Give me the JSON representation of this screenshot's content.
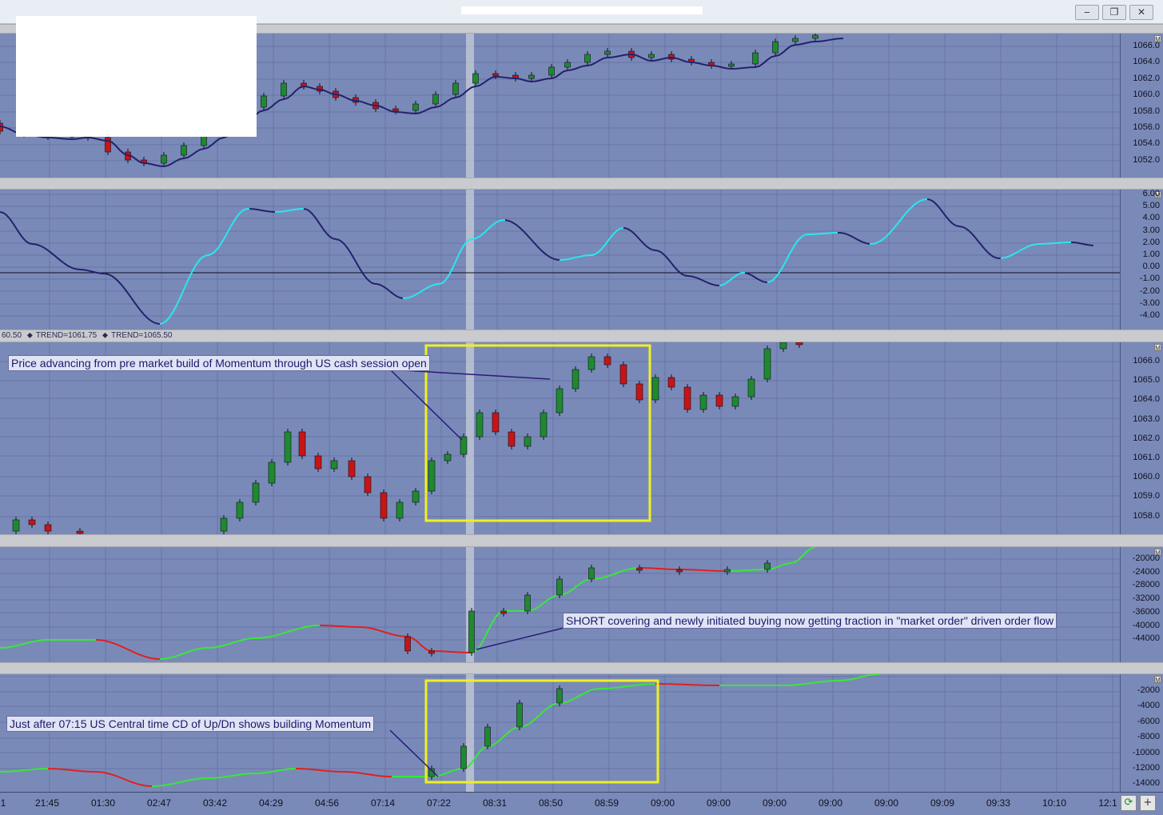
{
  "window": {
    "buttons": [
      "‒",
      "❐",
      "✕"
    ]
  },
  "panes": [
    {
      "id": "price-pane",
      "ticks": [
        "1066.0",
        "1064.0",
        "1062.0",
        "1060.0",
        "1058.0",
        "1056.0",
        "1054.0",
        "1052.0"
      ],
      "badge": "M"
    },
    {
      "id": "oscillator-pane",
      "ticks": [
        "6.00",
        "5.00",
        "4.00",
        "3.00",
        "2.00",
        "1.00",
        "0.00",
        "-1.00",
        "-2.00",
        "-3.00",
        "-4.00"
      ],
      "badge": "M"
    },
    {
      "id": "range-pane",
      "ticks": [
        "1066.0",
        "1065.0",
        "1064.0",
        "1063.0",
        "1062.0",
        "1061.0",
        "1060.0",
        "1059.0",
        "1058.0"
      ],
      "badge": "M",
      "header": [
        "60.50",
        "TREND=1061.75",
        "TREND=1065.50"
      ]
    },
    {
      "id": "volume-delta-pane",
      "ticks": [
        "-20000",
        "-24000",
        "-28000",
        "-32000",
        "-36000",
        "-40000",
        "-44000"
      ],
      "badge": "M"
    },
    {
      "id": "updn-pane",
      "ticks": [
        "-2000",
        "-4000",
        "-6000",
        "-8000",
        "-10000",
        "-12000",
        "-14000"
      ],
      "badge": "M"
    }
  ],
  "annotations": [
    "Price advancing from pre market build of Momentum through US cash session open",
    "SHORT covering and newly initiated buying now getting traction in \"market order\" driven order flow",
    "Just after 07:15 US Central time CD of Up/Dn shows building Momentum"
  ],
  "time_axis": [
    "1",
    "21:45",
    "01:30",
    "02:47",
    "03:42",
    "04:29",
    "04:56",
    "07:14",
    "07:22",
    "08:31",
    "08:50",
    "08:59",
    "09:00",
    "09:00",
    "09:00",
    "09:00",
    "09:00",
    "09:09",
    "09:33",
    "10:10",
    "12:1"
  ],
  "corner_buttons": [
    "⟳",
    "+"
  ],
  "colors": {
    "pane_bg": "#7a8ab8",
    "grid": "#6574a6",
    "up_candle": "#1e8a2e",
    "down_candle": "#c81414",
    "trend_line": "#24206e",
    "osc_up": "#28e8f0",
    "delta_up": "#38e838",
    "delta_down": "#e02020",
    "highlight_box": "#f0f020",
    "cursor_band": "#c8ccd8"
  }
}
